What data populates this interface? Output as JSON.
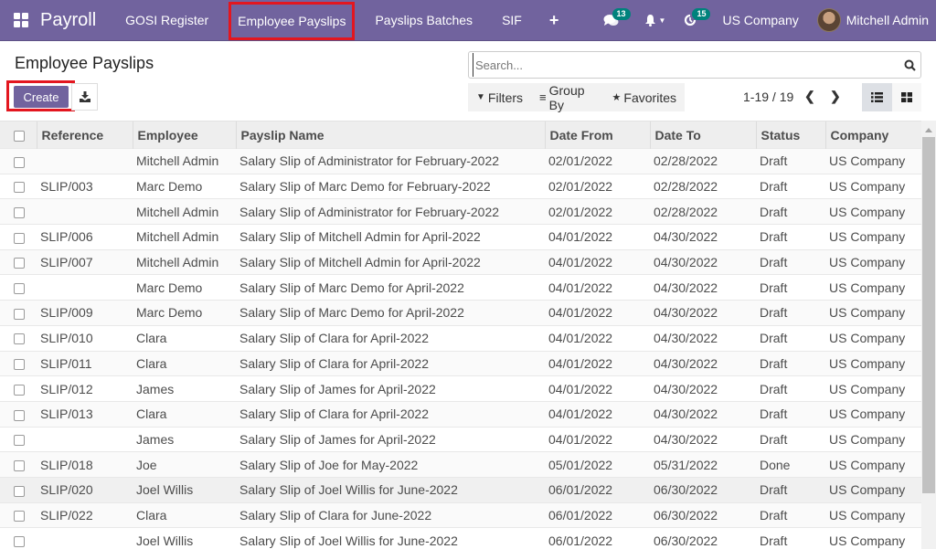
{
  "navbar": {
    "app_name": "Payroll",
    "menu": [
      {
        "label": "GOSI Register"
      },
      {
        "label": "Employee Payslips",
        "highlighted": true
      },
      {
        "label": "Payslips Batches"
      },
      {
        "label": "SIF"
      }
    ],
    "messages_count": "13",
    "activities_count": "15",
    "company": "US Company",
    "user": "Mitchell Admin"
  },
  "control_panel": {
    "title": "Employee Payslips",
    "create_label": "Create",
    "search_placeholder": "Search...",
    "filters_label": "Filters",
    "group_by_label": "Group By",
    "favorites_label": "Favorites",
    "pager": "1-19 / 19",
    "active_view": "list"
  },
  "colors": {
    "brand": "#71639e",
    "badge": "#00827c",
    "highlight": "#e3161f"
  },
  "table": {
    "columns": [
      "Reference",
      "Employee",
      "Payslip Name",
      "Date From",
      "Date To",
      "Status",
      "Company"
    ],
    "rows": [
      [
        "",
        "Mitchell Admin",
        "Salary Slip of Administrator for February-2022",
        "02/01/2022",
        "02/28/2022",
        "Draft",
        "US Company"
      ],
      [
        "SLIP/003",
        "Marc Demo",
        "Salary Slip of Marc Demo for February-2022",
        "02/01/2022",
        "02/28/2022",
        "Draft",
        "US Company"
      ],
      [
        "",
        "Mitchell Admin",
        "Salary Slip of Administrator for February-2022",
        "02/01/2022",
        "02/28/2022",
        "Draft",
        "US Company"
      ],
      [
        "SLIP/006",
        "Mitchell Admin",
        "Salary Slip of Mitchell Admin for April-2022",
        "04/01/2022",
        "04/30/2022",
        "Draft",
        "US Company"
      ],
      [
        "SLIP/007",
        "Mitchell Admin",
        "Salary Slip of Mitchell Admin for April-2022",
        "04/01/2022",
        "04/30/2022",
        "Draft",
        "US Company"
      ],
      [
        "",
        "Marc Demo",
        "Salary Slip of Marc Demo for April-2022",
        "04/01/2022",
        "04/30/2022",
        "Draft",
        "US Company"
      ],
      [
        "SLIP/009",
        "Marc Demo",
        "Salary Slip of Marc Demo for April-2022",
        "04/01/2022",
        "04/30/2022",
        "Draft",
        "US Company"
      ],
      [
        "SLIP/010",
        "Clara",
        "Salary Slip of Clara for April-2022",
        "04/01/2022",
        "04/30/2022",
        "Draft",
        "US Company"
      ],
      [
        "SLIP/011",
        "Clara",
        "Salary Slip of Clara for April-2022",
        "04/01/2022",
        "04/30/2022",
        "Draft",
        "US Company"
      ],
      [
        "SLIP/012",
        "James",
        "Salary Slip of James for April-2022",
        "04/01/2022",
        "04/30/2022",
        "Draft",
        "US Company"
      ],
      [
        "SLIP/013",
        "Clara",
        "Salary Slip of Clara for April-2022",
        "04/01/2022",
        "04/30/2022",
        "Draft",
        "US Company"
      ],
      [
        "",
        "James",
        "Salary Slip of James for April-2022",
        "04/01/2022",
        "04/30/2022",
        "Draft",
        "US Company"
      ],
      [
        "SLIP/018",
        "Joe",
        "Salary Slip of Joe for May-2022",
        "05/01/2022",
        "05/31/2022",
        "Done",
        "US Company"
      ],
      [
        "SLIP/020",
        "Joel Willis",
        "Salary Slip of Joel Willis for June-2022",
        "06/01/2022",
        "06/30/2022",
        "Draft",
        "US Company"
      ],
      [
        "SLIP/022",
        "Clara",
        "Salary Slip of Clara for June-2022",
        "06/01/2022",
        "06/30/2022",
        "Draft",
        "US Company"
      ],
      [
        "",
        "Joel Willis",
        "Salary Slip of Joel Willis for June-2022",
        "06/01/2022",
        "06/30/2022",
        "Draft",
        "US Company"
      ]
    ]
  }
}
